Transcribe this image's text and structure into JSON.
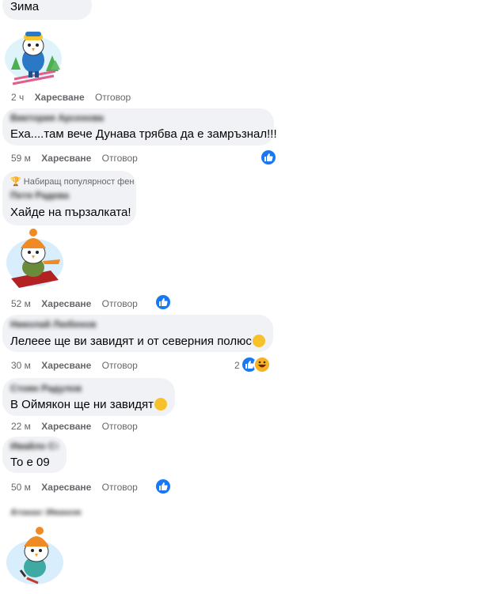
{
  "comments": [
    {
      "text": "Зима"
    },
    {
      "name": "Виктория Арсенова",
      "text": "Еха....там вече Дунава трябва да е замръзнал!!!"
    },
    {
      "badge": "Набиращ популярност фен",
      "name": "Петя Радева",
      "text": "Хайде на пързалката!"
    },
    {
      "name": "Николай Любенов",
      "text": "Лелеее ще ви завидят и от северния полюс"
    },
    {
      "name": "Стоян Радулов",
      "text": "В Оймякон ще ни завидят"
    },
    {
      "name": "Ивайло Ст.",
      "text": "То е 09"
    },
    {
      "name": "Атанас Иванов"
    }
  ],
  "meta": [
    {
      "time": "2 ч",
      "like": "Харесване",
      "reply": "Отговор"
    },
    {
      "time": "59 м",
      "like": "Харесване",
      "reply": "Отговор"
    },
    {
      "time": "52 м",
      "like": "Харесване",
      "reply": "Отговор"
    },
    {
      "time": "30 м",
      "like": "Харесване",
      "reply": "Отговор",
      "reaction_count": "2"
    },
    {
      "time": "22 м",
      "like": "Харесване",
      "reply": "Отговор"
    },
    {
      "time": "50 м",
      "like": "Харесване",
      "reply": "Отговор"
    }
  ],
  "stickers": [
    "penguin-skier-sticker",
    "penguin-sled-sticker",
    "penguin-skating-sticker"
  ],
  "colors": {
    "bubble": "#f0f2f5",
    "like_blue": "#1877f2",
    "meta_gray": "#65676b"
  }
}
